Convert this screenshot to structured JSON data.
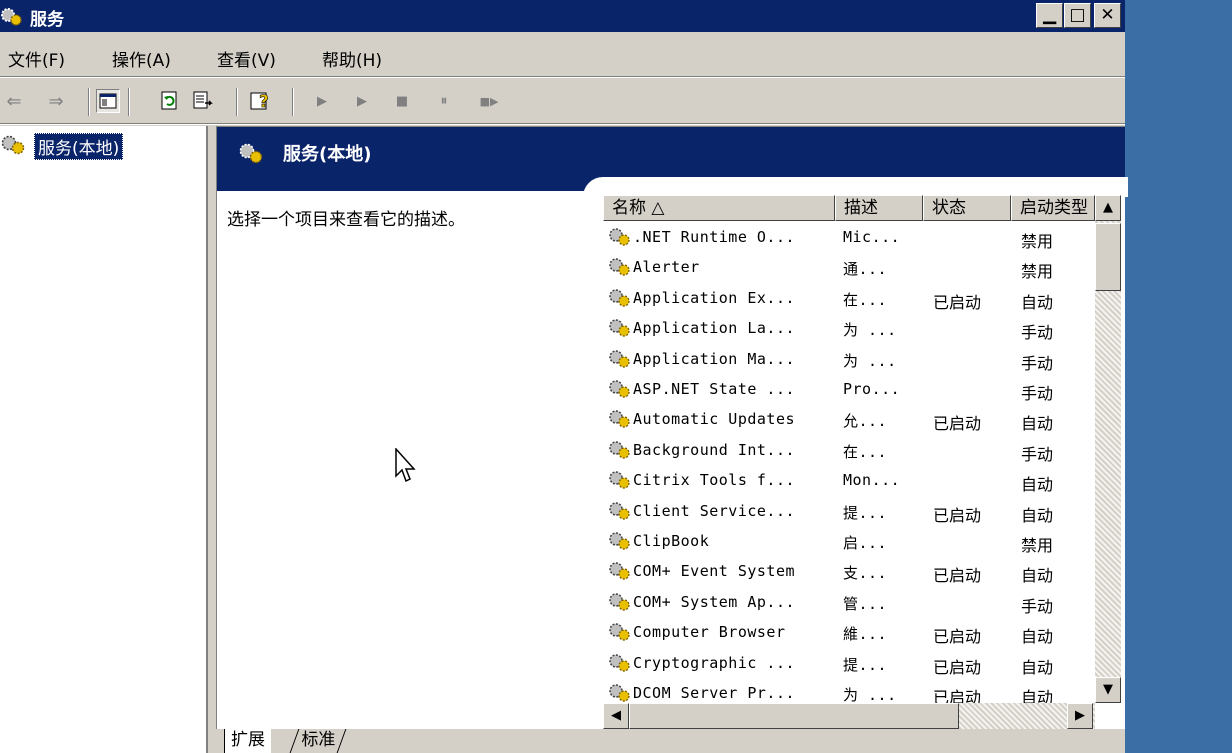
{
  "window": {
    "title": "服务",
    "min_glyph": "▁",
    "max_glyph": "□",
    "close_glyph": "✕"
  },
  "menu": [
    {
      "label": "文件(F)"
    },
    {
      "label": "操作(A)"
    },
    {
      "label": "查看(V)"
    },
    {
      "label": "帮助(H)"
    }
  ],
  "toolbar": {
    "back_glyph": "⇐",
    "forward_glyph": "⇒",
    "play_glyph": "▶",
    "play2_glyph": "▶",
    "stop_glyph": "■",
    "pause_glyph": "⏸",
    "restart_glyph": "■▶"
  },
  "tree": {
    "root_label": "服务(本地)"
  },
  "banner": {
    "title": "服务(本地)"
  },
  "description_hint": "选择一个项目来查看它的描述。",
  "list": {
    "columns": [
      {
        "label": "名称 △"
      },
      {
        "label": "描述"
      },
      {
        "label": "状态"
      },
      {
        "label": "启动类型"
      }
    ],
    "rows": [
      {
        "name": ".NET Runtime O...",
        "desc": "Mic...",
        "status": "",
        "startup": "禁用"
      },
      {
        "name": "Alerter",
        "desc": "通...",
        "status": "",
        "startup": "禁用"
      },
      {
        "name": "Application Ex...",
        "desc": "在...",
        "status": "已启动",
        "startup": "自动"
      },
      {
        "name": "Application La...",
        "desc": "为 ...",
        "status": "",
        "startup": "手动"
      },
      {
        "name": "Application Ma...",
        "desc": "为 ...",
        "status": "",
        "startup": "手动"
      },
      {
        "name": "ASP.NET State ...",
        "desc": "Pro...",
        "status": "",
        "startup": "手动"
      },
      {
        "name": "Automatic Updates",
        "desc": "允...",
        "status": "已启动",
        "startup": "自动"
      },
      {
        "name": "Background Int...",
        "desc": "在...",
        "status": "",
        "startup": "手动"
      },
      {
        "name": "Citrix Tools f...",
        "desc": "Mon...",
        "status": "",
        "startup": "自动"
      },
      {
        "name": "Client Service...",
        "desc": "提...",
        "status": "已启动",
        "startup": "自动"
      },
      {
        "name": "ClipBook",
        "desc": "启...",
        "status": "",
        "startup": "禁用"
      },
      {
        "name": "COM+ Event System",
        "desc": "支...",
        "status": "已启动",
        "startup": "自动"
      },
      {
        "name": "COM+ System Ap...",
        "desc": "管...",
        "status": "",
        "startup": "手动"
      },
      {
        "name": "Computer Browser",
        "desc": "維...",
        "status": "已启动",
        "startup": "自动"
      },
      {
        "name": "Cryptographic ...",
        "desc": "提...",
        "status": "已启动",
        "startup": "自动"
      },
      {
        "name": "DCOM Server Pr...",
        "desc": "为 ...",
        "status": "已启动",
        "startup": "自动"
      }
    ]
  },
  "scroll": {
    "up_glyph": "▲",
    "down_glyph": "▼",
    "left_glyph": "◀",
    "right_glyph": "▶"
  },
  "tabs": [
    {
      "label": "扩展"
    },
    {
      "label": "标准"
    }
  ]
}
